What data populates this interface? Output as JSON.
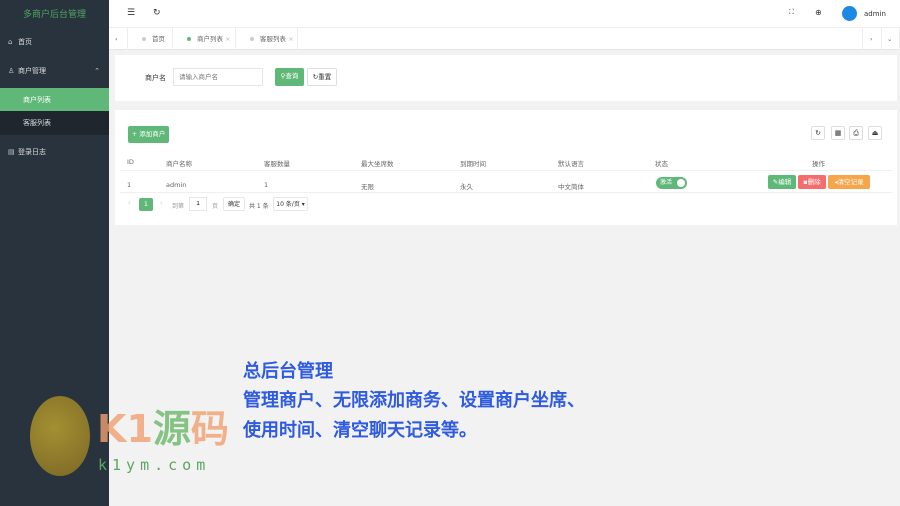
{
  "sidebar": {
    "title": "多商户后台管理",
    "items": [
      {
        "label": "首页"
      },
      {
        "label": "商户管理"
      },
      {
        "label": "商户列表"
      },
      {
        "label": "客服列表"
      },
      {
        "label": "登录日志"
      }
    ]
  },
  "header": {
    "user": "admin"
  },
  "tabs": [
    {
      "label": "首页"
    },
    {
      "label": "商户列表"
    },
    {
      "label": "客服列表"
    }
  ],
  "search": {
    "label": "商户名",
    "placeholder": "请输入商户名",
    "search_btn": "查询",
    "reset_btn": "重置"
  },
  "table": {
    "add_btn": "添加商户",
    "headers": [
      "ID",
      "商户名称",
      "客服数量",
      "最大坐席数",
      "到期时间",
      "默认语言",
      "状态",
      "操作"
    ],
    "rows": [
      {
        "id": "1",
        "name": "admin",
        "agents": "1",
        "max_seats": "无限",
        "expire": "永久",
        "lang": "中文简体",
        "status": "激活",
        "actions": [
          "编辑",
          "删除",
          "清空记录"
        ]
      }
    ]
  },
  "pagination": {
    "page": "1",
    "goto": "到第",
    "goto_value": "1",
    "page_unit": "页",
    "confirm": "确定",
    "total": "共 1 条",
    "per_page": "10 条/页"
  },
  "overlay": {
    "title": "总后台管理",
    "line1": "管理商户、无限添加商务、设置商户坐席、",
    "line2": "使用时间、清空聊天记录等。"
  },
  "watermark": {
    "brand": "K1源码",
    "url": "k1ym.com"
  }
}
